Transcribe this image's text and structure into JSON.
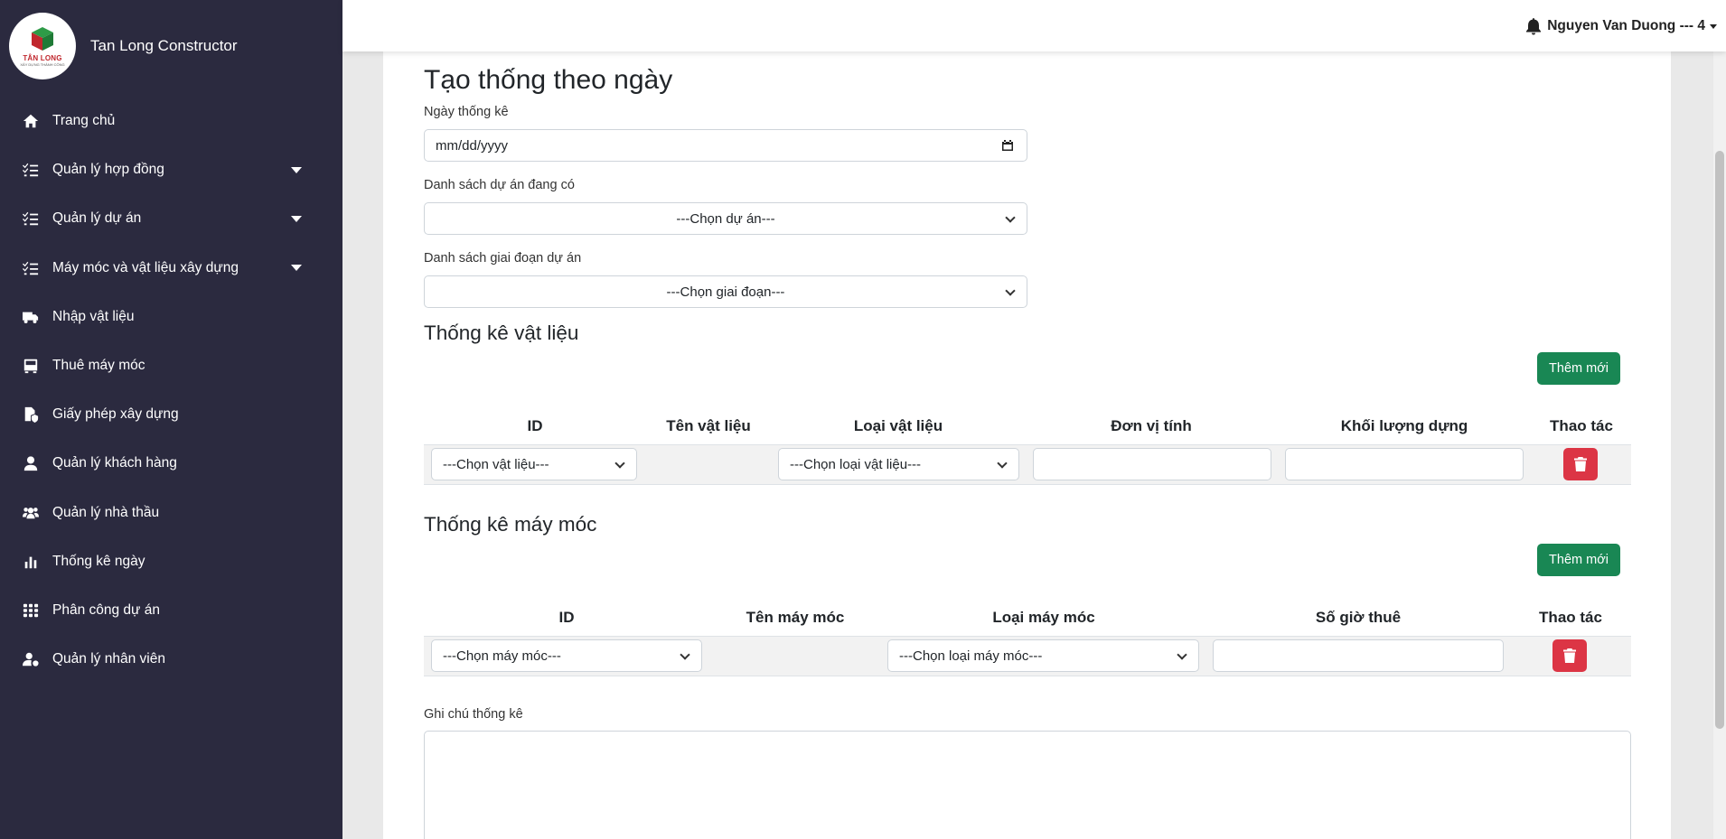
{
  "app": {
    "brand_name": "Tan Long Constructor",
    "logo_text": "TÂN LONG",
    "logo_sub": "XÂY DỰNG THÀNH CÔNG"
  },
  "sidebar": {
    "items": [
      {
        "label": "Trang chủ",
        "icon": "home-icon",
        "has_caret": false
      },
      {
        "label": "Quản lý hợp đồng",
        "icon": "list-check-icon",
        "has_caret": true
      },
      {
        "label": "Quản lý dự án",
        "icon": "list-check-icon",
        "has_caret": true
      },
      {
        "label": "Máy móc và vật liệu xây dựng",
        "icon": "list-check-icon",
        "has_caret": true
      },
      {
        "label": "Nhập vật liệu",
        "icon": "truck-icon",
        "has_caret": false
      },
      {
        "label": "Thuê máy móc",
        "icon": "bus-icon",
        "has_caret": false
      },
      {
        "label": "Giấy phép xây dựng",
        "icon": "file-shield-icon",
        "has_caret": false
      },
      {
        "label": "Quản lý khách hàng",
        "icon": "user-icon",
        "has_caret": false
      },
      {
        "label": "Quản lý nhà thầu",
        "icon": "users-icon",
        "has_caret": false
      },
      {
        "label": "Thống kê ngày",
        "icon": "chart-bar-icon",
        "has_caret": false
      },
      {
        "label": "Phân công dự án",
        "icon": "grid-icon",
        "has_caret": false
      },
      {
        "label": "Quản lý nhân viên",
        "icon": "user-gear-icon",
        "has_caret": false
      }
    ]
  },
  "topbar": {
    "user_name": "Nguyen Van Duong --- 4"
  },
  "form": {
    "title": "Tạo thống theo ngày",
    "date_label": "Ngày thống kê",
    "date_placeholder": "mm/dd/yyyy",
    "project_label": "Danh sách dự án đang có",
    "project_select": "---Chọn dự án---",
    "phase_label": "Danh sách giai đoạn dự án",
    "phase_select": "---Chọn giai đoạn---",
    "note_label": "Ghi chú thống kê"
  },
  "materials": {
    "heading": "Thống kê vật liệu",
    "add_button": "Thêm mới",
    "columns": [
      "ID",
      "Tên vật liệu",
      "Loại vật liệu",
      "Đơn vị tính",
      "Khối lượng dựng",
      "Thao tác"
    ],
    "row": {
      "id_select": "---Chọn vật liệu---",
      "type_select": "---Chọn loại vật liệu---"
    }
  },
  "machines": {
    "heading": "Thống kê máy móc",
    "add_button": "Thêm mới",
    "columns": [
      "ID",
      "Tên máy móc",
      "Loại máy móc",
      "Số giờ thuê",
      "Thao tác"
    ],
    "row": {
      "id_select": "---Chọn máy móc---",
      "type_select": "---Chọn loại máy móc---"
    }
  },
  "colors": {
    "sidebar_bg": "#2b2a3f",
    "success": "#198754",
    "danger": "#dc3545"
  }
}
